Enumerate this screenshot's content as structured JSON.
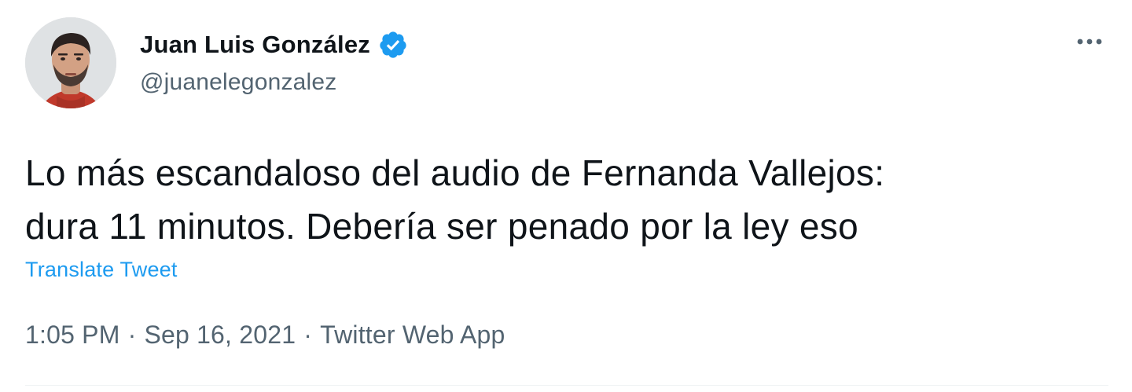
{
  "author": {
    "name": "Juan Luis González",
    "handle": "@juanelegonzalez",
    "verified": true
  },
  "tweet": {
    "text_lines": [
      "Lo más escandaloso del audio de Fernanda Vallejos:",
      "dura 11 minutos. Debería ser penado por la ley eso"
    ],
    "translate_label": "Translate Tweet"
  },
  "meta": {
    "time": "1:05 PM",
    "separator": "·",
    "date": "Sep 16, 2021",
    "source": "Twitter Web App"
  },
  "icons": {
    "verified": "verified-badge-icon",
    "more": "more-options-icon",
    "avatar": "profile-photo"
  },
  "colors": {
    "accent": "#1d9bf0",
    "text_primary": "#0f1419",
    "text_secondary": "#536471",
    "divider": "#eff3f4"
  }
}
